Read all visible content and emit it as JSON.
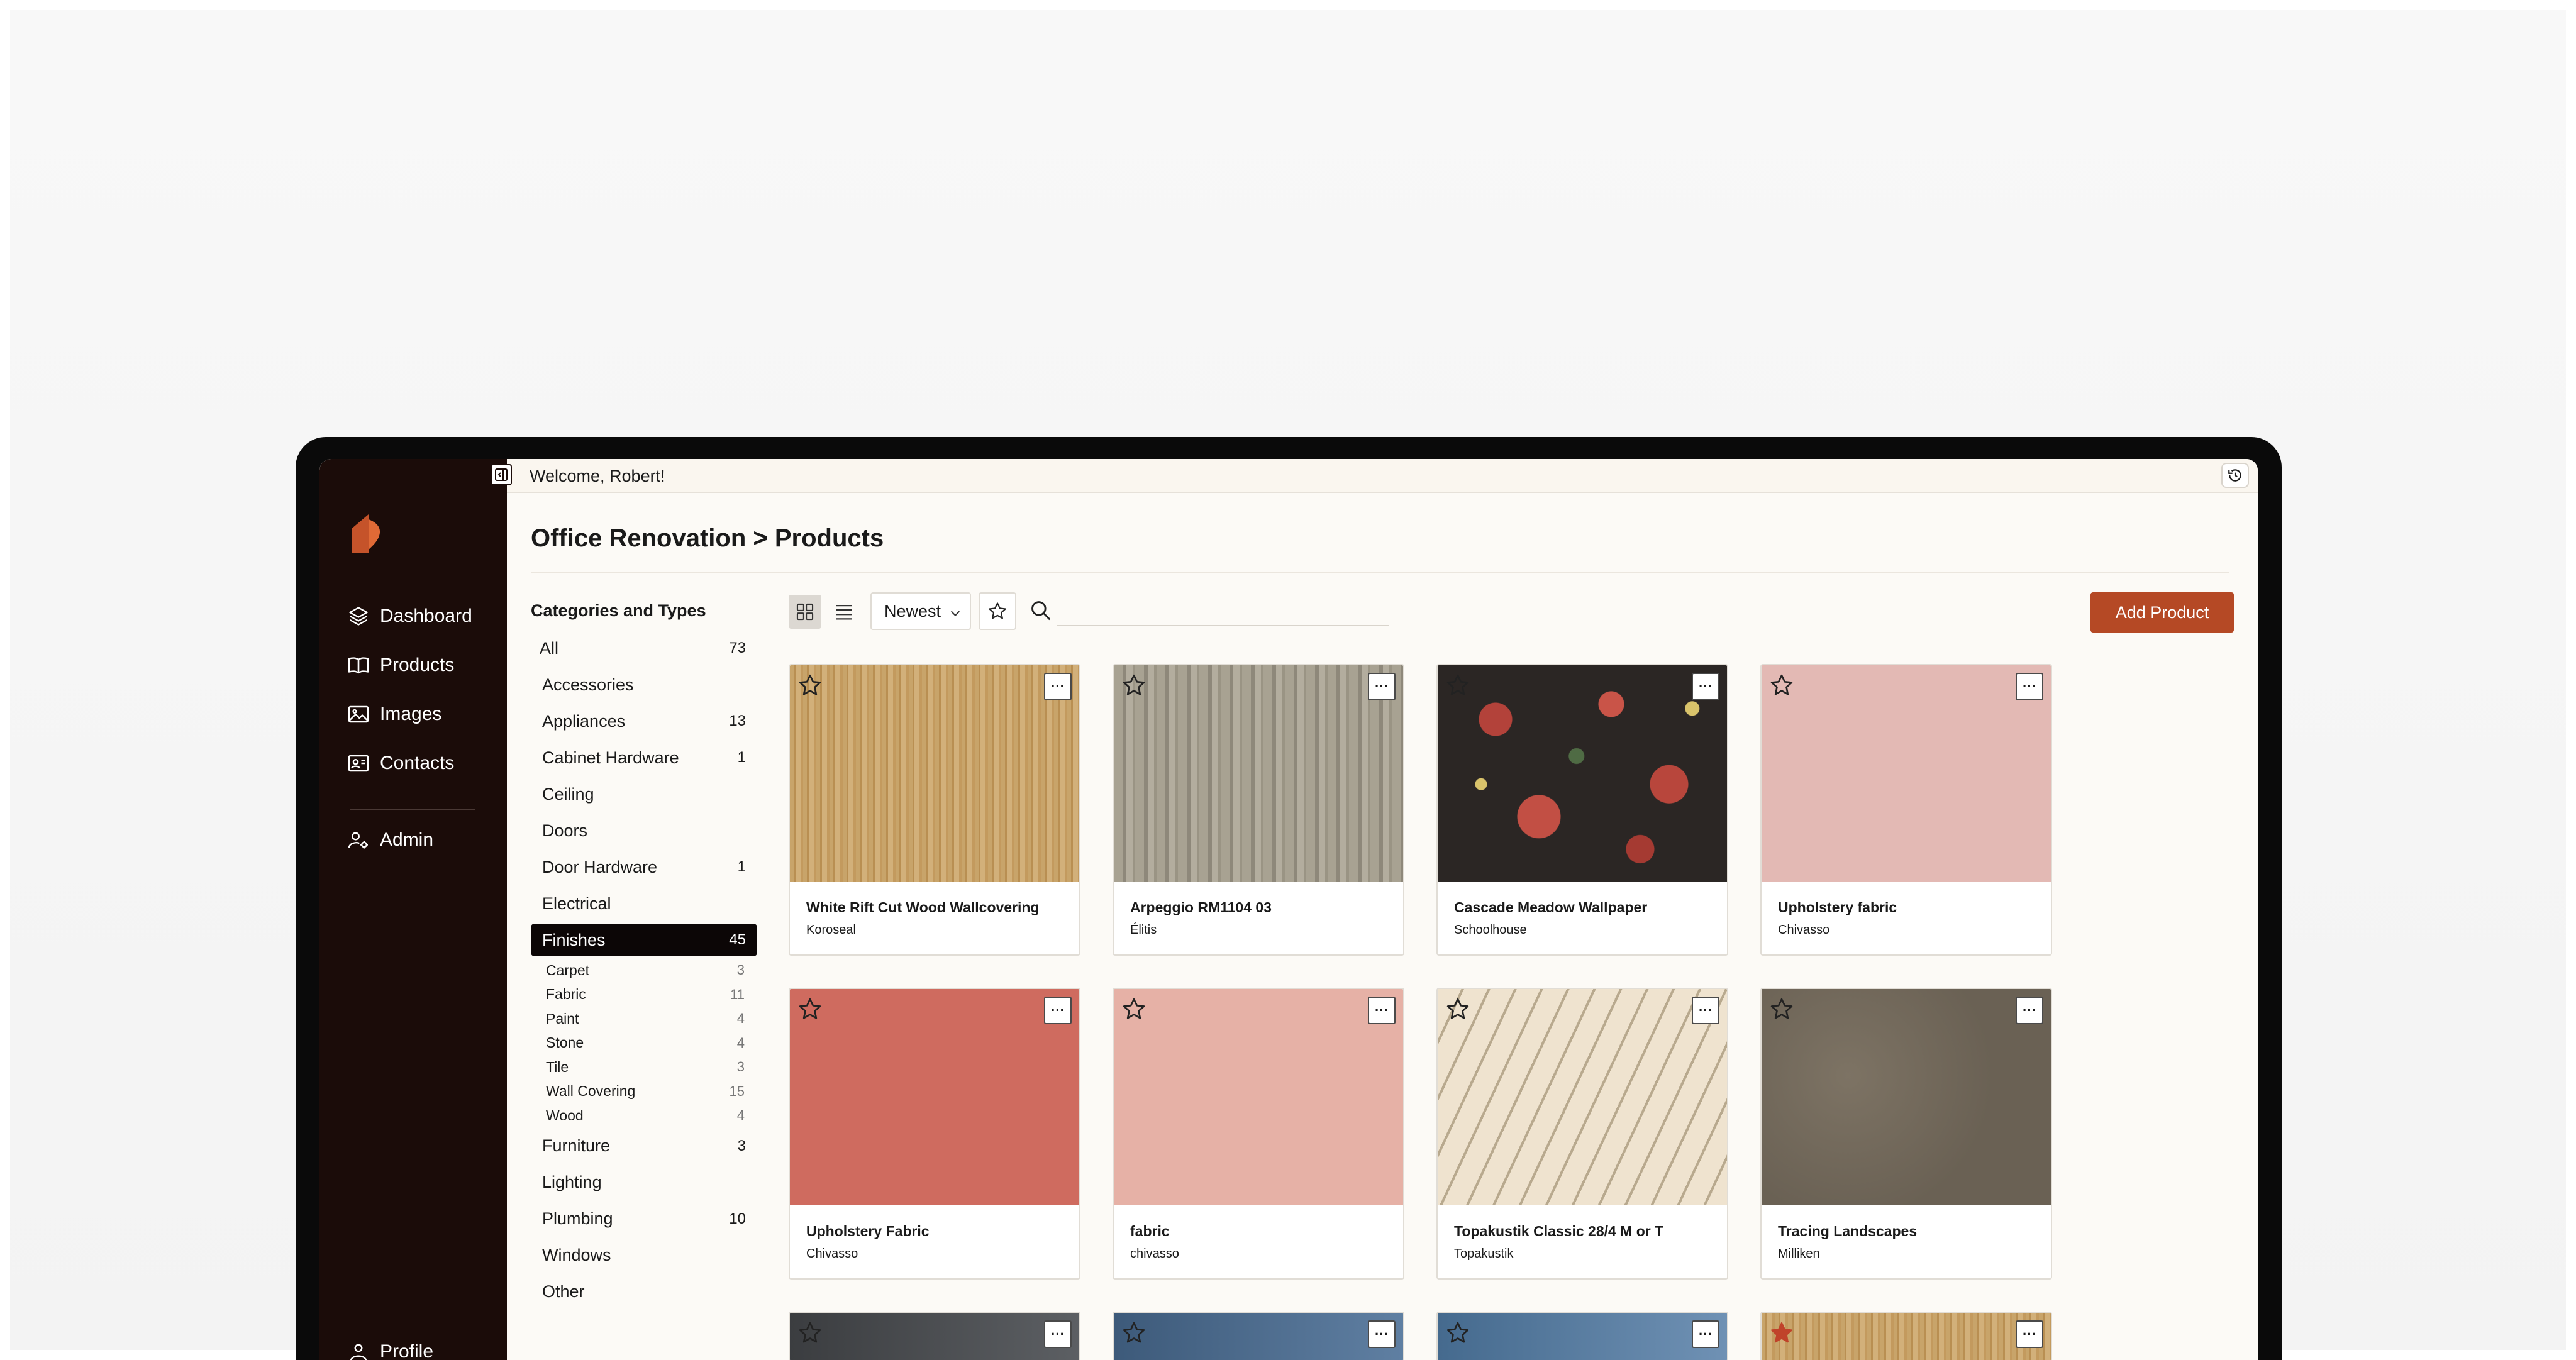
{
  "user": {
    "welcome": "Welcome, Robert!"
  },
  "sidebar": {
    "items": [
      {
        "label": "Dashboard",
        "icon": "layers-icon"
      },
      {
        "label": "Products",
        "icon": "book-icon"
      },
      {
        "label": "Images",
        "icon": "image-icon"
      },
      {
        "label": "Contacts",
        "icon": "contact-card-icon"
      },
      {
        "label": "Admin",
        "icon": "user-gear-icon"
      }
    ],
    "profile_label": "Profile"
  },
  "page": {
    "title": "Office Renovation > Products"
  },
  "categories": {
    "heading": "Categories and Types",
    "all": {
      "label": "All",
      "count": "73"
    },
    "before": [
      {
        "label": "Accessories",
        "count": ""
      },
      {
        "label": "Appliances",
        "count": "13"
      },
      {
        "label": "Cabinet Hardware",
        "count": "1"
      },
      {
        "label": "Ceiling",
        "count": ""
      },
      {
        "label": "Doors",
        "count": ""
      },
      {
        "label": "Door Hardware",
        "count": "1"
      },
      {
        "label": "Electrical",
        "count": ""
      }
    ],
    "active": {
      "label": "Finishes",
      "count": "45"
    },
    "sub": [
      {
        "label": "Carpet",
        "count": "3"
      },
      {
        "label": "Fabric",
        "count": "11"
      },
      {
        "label": "Paint",
        "count": "4"
      },
      {
        "label": "Stone",
        "count": "4"
      },
      {
        "label": "Tile",
        "count": "3"
      },
      {
        "label": "Wall Covering",
        "count": "15"
      },
      {
        "label": "Wood",
        "count": "4"
      }
    ],
    "after": [
      {
        "label": "Furniture",
        "count": "3"
      },
      {
        "label": "Lighting",
        "count": ""
      },
      {
        "label": "Plumbing",
        "count": "10"
      },
      {
        "label": "Windows",
        "count": ""
      },
      {
        "label": "Other",
        "count": ""
      }
    ]
  },
  "toolbar": {
    "sort_value": "Newest",
    "search_placeholder": "",
    "add_label": "Add Product",
    "accent": "#b54925"
  },
  "products": [
    {
      "name": "White Rift Cut Wood Wallcovering",
      "brand": "Koroseal",
      "favorite": false,
      "swatch": "wood-light"
    },
    {
      "name": "Arpeggio RM1104 03",
      "brand": "Élitis",
      "favorite": false,
      "swatch": "stripe-grey"
    },
    {
      "name": "Cascade Meadow Wallpaper",
      "brand": "Schoolhouse",
      "favorite": false,
      "swatch": "floral-dark"
    },
    {
      "name": "Upholstery fabric",
      "brand": "Chivasso",
      "favorite": false,
      "swatch": "blush"
    },
    {
      "name": "Upholstery Fabric",
      "brand": "Chivasso",
      "favorite": false,
      "swatch": "coral"
    },
    {
      "name": "fabric",
      "brand": "chivasso",
      "favorite": false,
      "swatch": "pink"
    },
    {
      "name": "Topakustik Classic 28/4 M or T",
      "brand": "Topakustik",
      "favorite": false,
      "swatch": "acoustic"
    },
    {
      "name": "Tracing Landscapes",
      "brand": "Milliken",
      "favorite": false,
      "swatch": "carpet-taupe"
    }
  ],
  "products_partial": [
    {
      "favorite": false,
      "swatch": "dark-slate"
    },
    {
      "favorite": false,
      "swatch": "blue"
    },
    {
      "favorite": false,
      "swatch": "blue-tower"
    },
    {
      "favorite": true,
      "swatch": "wood-light"
    }
  ]
}
